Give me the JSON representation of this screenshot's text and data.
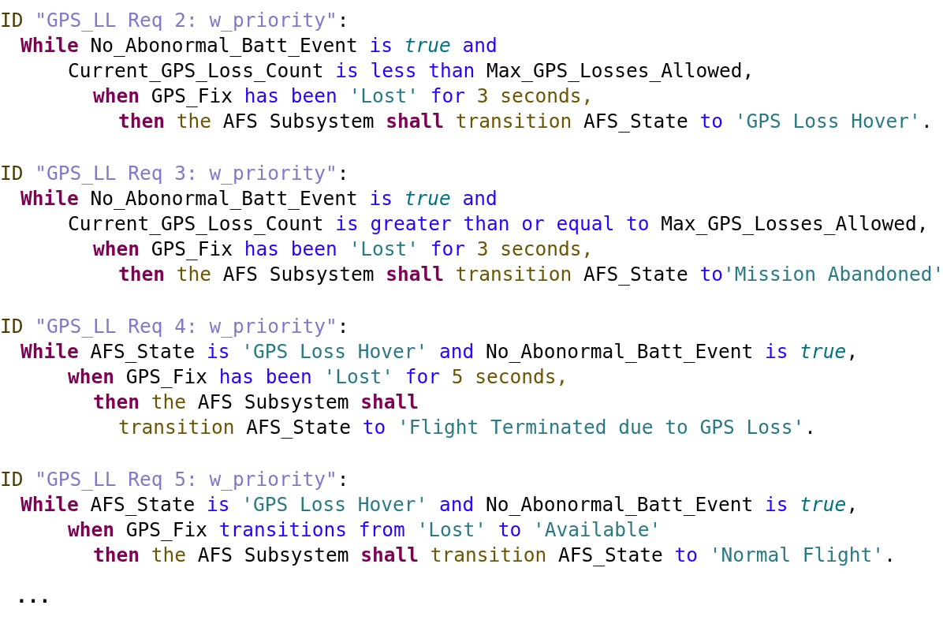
{
  "requirements": [
    {
      "header": [
        {
          "kind": "keyword_id",
          "text": "ID "
        },
        {
          "kind": "id_string",
          "text": "\"GPS_LL Req 2: w_priority\""
        },
        {
          "kind": "name",
          "text": ":"
        }
      ],
      "lines": [
        {
          "tokens": [
            {
              "kind": "keyword",
              "text": "While "
            },
            {
              "kind": "name",
              "text": "No_Abonormal_Batt_Event "
            },
            {
              "kind": "operator",
              "text": "is "
            },
            {
              "kind": "boolean",
              "text": "true"
            },
            {
              "kind": "operator",
              "text": " and"
            }
          ],
          "children": [
            {
              "tokens": [
                {
                  "kind": "name",
                  "text": "Current_GPS_Loss_Count "
                },
                {
                  "kind": "operator",
                  "text": "is less than "
                },
                {
                  "kind": "name",
                  "text": "Max_GPS_Losses_Allowed,"
                }
              ],
              "children": [
                {
                  "tokens": [
                    {
                      "kind": "keyword",
                      "text": "when "
                    },
                    {
                      "kind": "name",
                      "text": "GPS_Fix "
                    },
                    {
                      "kind": "operator",
                      "text": "has been "
                    },
                    {
                      "kind": "literal",
                      "text": "'Lost' "
                    },
                    {
                      "kind": "operator",
                      "text": "for "
                    },
                    {
                      "kind": "word",
                      "text": "3 seconds,"
                    }
                  ],
                  "children": [
                    {
                      "tokens": [
                        {
                          "kind": "keyword",
                          "text": "then "
                        },
                        {
                          "kind": "word",
                          "text": "the "
                        },
                        {
                          "kind": "name",
                          "text": "AFS Subsystem "
                        },
                        {
                          "kind": "keyword",
                          "text": "shall "
                        },
                        {
                          "kind": "word",
                          "text": "transition "
                        },
                        {
                          "kind": "name",
                          "text": "AFS_State "
                        },
                        {
                          "kind": "operator",
                          "text": "to "
                        },
                        {
                          "kind": "literal",
                          "text": "'GPS Loss Hover'"
                        },
                        {
                          "kind": "name",
                          "text": "."
                        }
                      ]
                    }
                  ]
                }
              ]
            }
          ]
        }
      ]
    },
    {
      "header": [
        {
          "kind": "keyword_id",
          "text": "ID "
        },
        {
          "kind": "id_string",
          "text": "\"GPS_LL Req 3: w_priority\""
        },
        {
          "kind": "name",
          "text": ":"
        }
      ],
      "lines": [
        {
          "tokens": [
            {
              "kind": "keyword",
              "text": "While "
            },
            {
              "kind": "name",
              "text": "No_Abonormal_Batt_Event "
            },
            {
              "kind": "operator",
              "text": "is "
            },
            {
              "kind": "boolean",
              "text": "true"
            },
            {
              "kind": "operator",
              "text": " and"
            }
          ],
          "children": [
            {
              "tokens": [
                {
                  "kind": "name",
                  "text": "Current_GPS_Loss_Count "
                },
                {
                  "kind": "operator",
                  "text": "is greater than or equal to "
                },
                {
                  "kind": "name",
                  "text": "Max_GPS_Losses_Allowed,"
                }
              ],
              "children": [
                {
                  "tokens": [
                    {
                      "kind": "keyword",
                      "text": "when "
                    },
                    {
                      "kind": "name",
                      "text": "GPS_Fix "
                    },
                    {
                      "kind": "operator",
                      "text": "has been "
                    },
                    {
                      "kind": "literal",
                      "text": "'Lost' "
                    },
                    {
                      "kind": "operator",
                      "text": "for "
                    },
                    {
                      "kind": "word",
                      "text": "3 seconds,"
                    }
                  ],
                  "children": [
                    {
                      "tokens": [
                        {
                          "kind": "keyword",
                          "text": "then "
                        },
                        {
                          "kind": "word",
                          "text": "the "
                        },
                        {
                          "kind": "name",
                          "text": "AFS Subsystem "
                        },
                        {
                          "kind": "keyword",
                          "text": "shall "
                        },
                        {
                          "kind": "word",
                          "text": "transition "
                        },
                        {
                          "kind": "name",
                          "text": "AFS_State "
                        },
                        {
                          "kind": "operator",
                          "text": "to"
                        },
                        {
                          "kind": "literal",
                          "text": "'Mission Abandoned'"
                        }
                      ]
                    }
                  ]
                }
              ]
            }
          ]
        }
      ]
    },
    {
      "header": [
        {
          "kind": "keyword_id",
          "text": "ID "
        },
        {
          "kind": "id_string",
          "text": "\"GPS_LL Req 4: w_priority\""
        },
        {
          "kind": "name",
          "text": ":"
        }
      ],
      "lines": [
        {
          "tokens": [
            {
              "kind": "keyword",
              "text": "While "
            },
            {
              "kind": "name",
              "text": "AFS_State "
            },
            {
              "kind": "operator",
              "text": "is "
            },
            {
              "kind": "literal",
              "text": "'GPS Loss Hover' "
            },
            {
              "kind": "operator",
              "text": "and "
            },
            {
              "kind": "name",
              "text": "No_Abonormal_Batt_Event "
            },
            {
              "kind": "operator",
              "text": "is "
            },
            {
              "kind": "boolean",
              "text": "true"
            },
            {
              "kind": "name",
              "text": ","
            }
          ],
          "children": [
            {
              "tokens": [
                {
                  "kind": "keyword",
                  "text": "when "
                },
                {
                  "kind": "name",
                  "text": "GPS_Fix "
                },
                {
                  "kind": "operator",
                  "text": "has been "
                },
                {
                  "kind": "literal",
                  "text": "'Lost' "
                },
                {
                  "kind": "operator",
                  "text": "for "
                },
                {
                  "kind": "word",
                  "text": "5 seconds,"
                }
              ],
              "children": [
                {
                  "tokens": [
                    {
                      "kind": "keyword",
                      "text": "then "
                    },
                    {
                      "kind": "word",
                      "text": "the "
                    },
                    {
                      "kind": "name",
                      "text": "AFS Subsystem "
                    },
                    {
                      "kind": "keyword",
                      "text": "shall"
                    }
                  ],
                  "children": [
                    {
                      "tokens": [
                        {
                          "kind": "word",
                          "text": "transition "
                        },
                        {
                          "kind": "name",
                          "text": "AFS_State "
                        },
                        {
                          "kind": "operator",
                          "text": "to "
                        },
                        {
                          "kind": "literal",
                          "text": "'Flight Terminated due to GPS Loss'"
                        },
                        {
                          "kind": "name",
                          "text": "."
                        }
                      ]
                    }
                  ]
                }
              ]
            }
          ]
        }
      ]
    },
    {
      "header": [
        {
          "kind": "keyword_id",
          "text": "ID "
        },
        {
          "kind": "id_string",
          "text": "\"GPS_LL Req 5: w_priority\""
        },
        {
          "kind": "name",
          "text": ":"
        }
      ],
      "lines": [
        {
          "tokens": [
            {
              "kind": "keyword",
              "text": "While "
            },
            {
              "kind": "name",
              "text": "AFS_State "
            },
            {
              "kind": "operator",
              "text": "is "
            },
            {
              "kind": "literal",
              "text": "'GPS Loss Hover' "
            },
            {
              "kind": "operator",
              "text": "and "
            },
            {
              "kind": "name",
              "text": "No_Abonormal_Batt_Event "
            },
            {
              "kind": "operator",
              "text": "is "
            },
            {
              "kind": "boolean",
              "text": "true"
            },
            {
              "kind": "name",
              "text": ","
            }
          ],
          "children": [
            {
              "tokens": [
                {
                  "kind": "keyword",
                  "text": "when "
                },
                {
                  "kind": "name",
                  "text": "GPS_Fix "
                },
                {
                  "kind": "operator",
                  "text": "transitions from "
                },
                {
                  "kind": "literal",
                  "text": "'Lost' "
                },
                {
                  "kind": "operator",
                  "text": "to "
                },
                {
                  "kind": "literal",
                  "text": "'Available'"
                }
              ],
              "children": [
                {
                  "tokens": [
                    {
                      "kind": "keyword",
                      "text": "then "
                    },
                    {
                      "kind": "word",
                      "text": "the "
                    },
                    {
                      "kind": "name",
                      "text": "AFS Subsystem "
                    },
                    {
                      "kind": "keyword",
                      "text": "shall "
                    },
                    {
                      "kind": "word",
                      "text": "transition "
                    },
                    {
                      "kind": "name",
                      "text": "AFS_State "
                    },
                    {
                      "kind": "operator",
                      "text": "to "
                    },
                    {
                      "kind": "literal",
                      "text": "'Normal Flight'"
                    },
                    {
                      "kind": "name",
                      "text": "."
                    }
                  ]
                }
              ]
            }
          ]
        }
      ]
    }
  ],
  "ellipsis": "..."
}
